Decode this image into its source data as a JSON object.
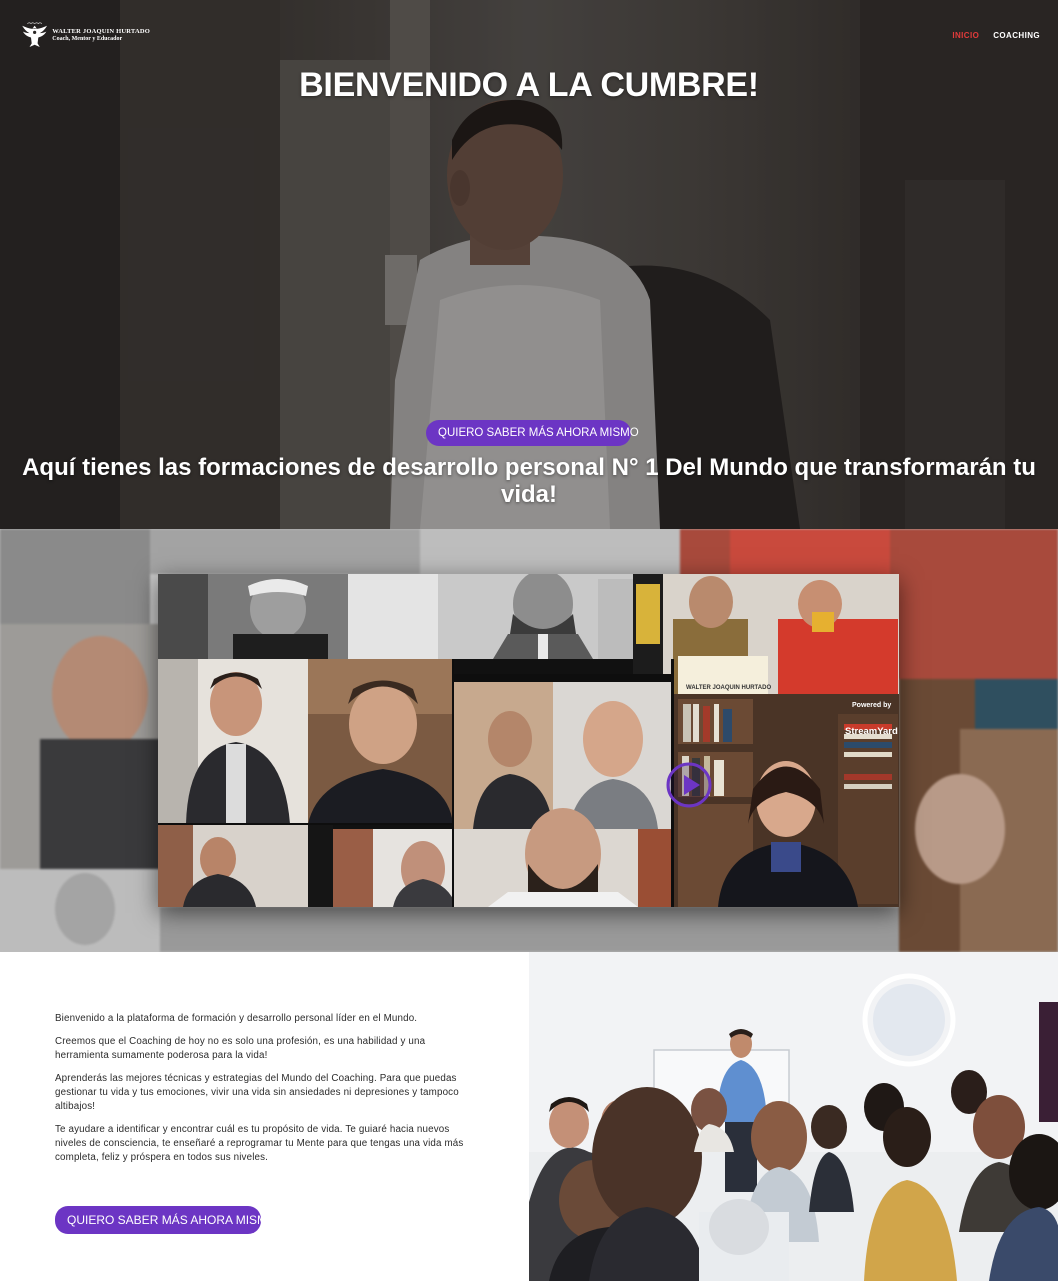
{
  "header": {
    "logo": {
      "name": "WALTER JOAQUIN HURTADO",
      "subtitle": "Coach, Mentor y Educador"
    },
    "nav": [
      {
        "label": "INICIO",
        "active": true
      },
      {
        "label": "COACHING",
        "active": false
      }
    ]
  },
  "hero": {
    "title": "BIENVENIDO A LA CUMBRE!",
    "cta_label": "QUIERO SABER MÁS AHORA MISMO",
    "subtitle": "Aquí tienes las formaciones de desarrollo personal N° 1 Del Mundo que transformarán tu vida!"
  },
  "video": {
    "certificate_label": "WALTER JOAQUIN HURTADO",
    "streamyard_powered": "Powered by",
    "streamyard_brand": "StreamYard"
  },
  "info": {
    "paragraphs": [
      "Bienvenido a la plataforma de formación y desarrollo personal líder en el Mundo.",
      "Creemos que el Coaching de hoy no es solo una profesión, es una habilidad y una herramienta sumamente poderosa para la vida!",
      "Aprenderás las mejores técnicas y estrategias del Mundo del Coaching. Para que puedas gestionar tu vida y tus emociones, vivir una vida sin ansiedades ni depresiones y tampoco altibajos!",
      "Te ayudare a identificar y encontrar cuál es tu propósito de vida. Te guiaré hacia nuevos niveles de consciencia, te enseñaré a reprogramar tu Mente para que tengas una vida más completa, feliz y próspera en todos sus niveles."
    ],
    "cta_label": "QUIERO SABER MÁS AHORA MISMO"
  },
  "colors": {
    "accent": "#6c35c4",
    "nav_active": "#e23b3b"
  }
}
